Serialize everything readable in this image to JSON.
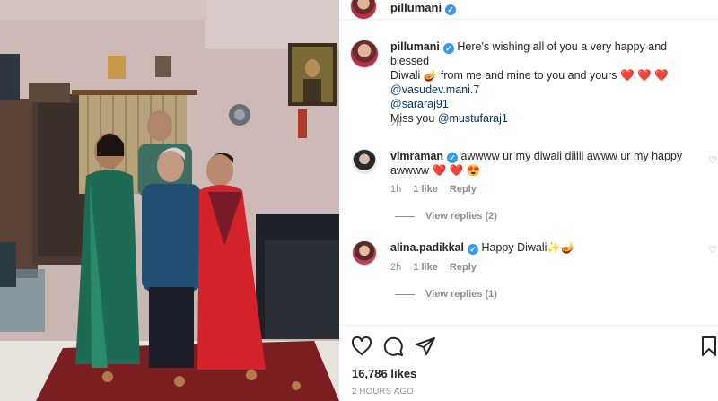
{
  "header": {
    "username": "pillumani",
    "verified": true
  },
  "caption": {
    "username": "pillumani",
    "line1": "Here's wishing all of you a very happy and blessed",
    "line2_a": "Diwali",
    "emoji_diya": "🪔",
    "line2_b": "from me and mine to you and yours",
    "hearts": "❤️ ❤️ ❤️",
    "mention1": "@vasudev.mani.7",
    "mention2": "@sararaj91",
    "miss_prefix": "Miss you",
    "mention3": "@mustufaraj1",
    "time": "2h"
  },
  "comments": [
    {
      "username": "vimraman",
      "verified": true,
      "text1": "awwww ur my diwali diiiii awww ur my happy",
      "text2": "awwww",
      "emojis": "❤️ ❤️ 😍",
      "time": "1h",
      "likes": "1 like",
      "reply": "Reply",
      "view_replies": "View replies (2)"
    },
    {
      "username": "alina.padikkal",
      "verified": true,
      "text1": "Happy Diwali",
      "emojis": "✨🪔",
      "time": "2h",
      "likes": "1 like",
      "reply": "Reply",
      "view_replies": "View replies (1)"
    }
  ],
  "actions": {
    "icons": [
      "heart-icon",
      "comment-icon",
      "share-icon",
      "bookmark-icon"
    ]
  },
  "likes_count": "16,786 likes",
  "posted": "2 HOURS AGO",
  "colors": {
    "verified": "#3897f0",
    "secondary_text": "#8e8e8e",
    "heart": "#ed4956"
  }
}
